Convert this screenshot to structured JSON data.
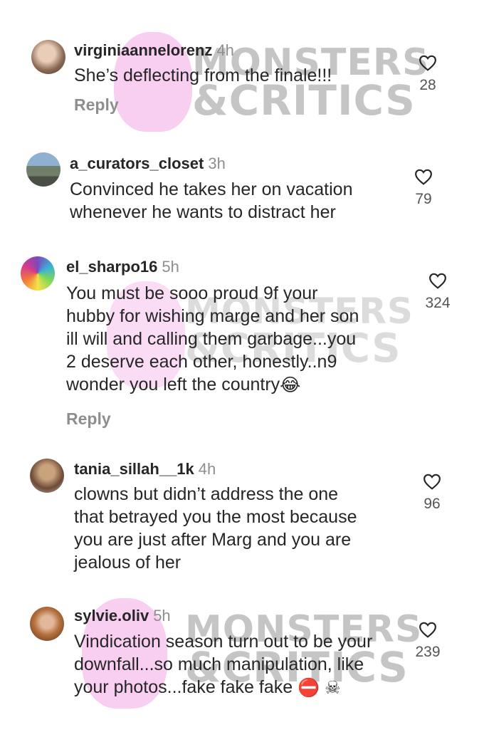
{
  "comments": [
    {
      "username": "virginiaannelorenz",
      "time": "4h",
      "lines": [
        "She’s deflecting from the finale!!!"
      ],
      "reply": "Reply",
      "likes": "28",
      "avatar_icon": "profile-photo"
    },
    {
      "username": "a_curators_closet",
      "time": "3h",
      "lines": [
        "Convinced he takes her on vacation",
        "whenever he wants to distract her"
      ],
      "likes": "79",
      "avatar_icon": "profile-photo"
    },
    {
      "username": "el_sharpo16",
      "time": "5h",
      "lines": [
        "You must be sooo proud 9f your",
        "hubby for wishing marge and her son",
        "ill will and calling them garbage...you",
        "2 deserve each other, honestly..n9",
        "wonder you left the country"
      ],
      "emoji": "😂",
      "reply": "Reply",
      "likes": "324",
      "avatar_icon": "profile-photo"
    },
    {
      "username": "tania_sillah__1k",
      "time": "4h",
      "lines": [
        "clowns but didn’t address the one",
        "that betrayed you the most because",
        "you are just after Marg and you are",
        "jealous of her"
      ],
      "likes": "96",
      "avatar_icon": "profile-photo"
    },
    {
      "username": "sylvie.oliv",
      "time": "5h",
      "lines": [
        "Vindication season turn out to be your",
        "downfall...so much manipulation, like",
        "your photos...fake fake fake"
      ],
      "emoji": "⛔ ☠",
      "likes": "239",
      "avatar_icon": "profile-photo"
    }
  ],
  "watermark": {
    "line1": "MONSTERS",
    "line2": "&CRITICS"
  },
  "colors": {
    "text": "#262626",
    "muted": "#8e8e8e",
    "watermark_pink": "#f7c6ee"
  },
  "icons": {
    "like": "heart-outline-icon"
  }
}
